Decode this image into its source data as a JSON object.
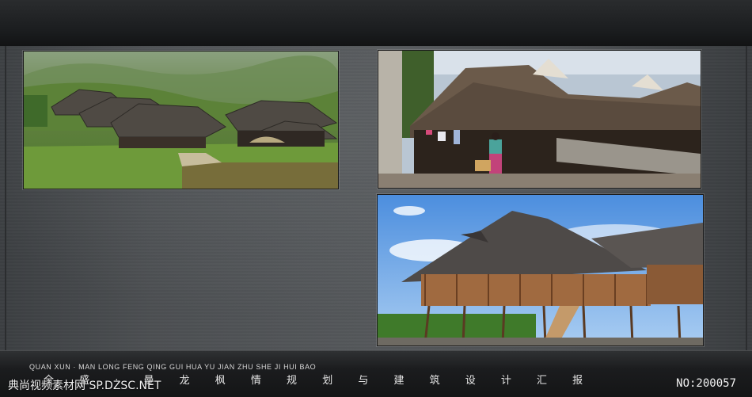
{
  "footer": {
    "pinyin_title": "QUAN XUN · MAN LONG FENG QING GUI HUA YU JIAN ZHU SHE JI HUI BAO",
    "chinese_title": "全  盛 · 曼 龙 枫 情 规 划 与 建 筑 设 计 汇 报",
    "watermark": "典尚视频素材网 SP.DZSC.NET",
    "slide_number": "NO:200057"
  },
  "colors": {
    "panel": "#4c4f52",
    "frame": "#1d1f21",
    "text": "#e6e6e6"
  }
}
